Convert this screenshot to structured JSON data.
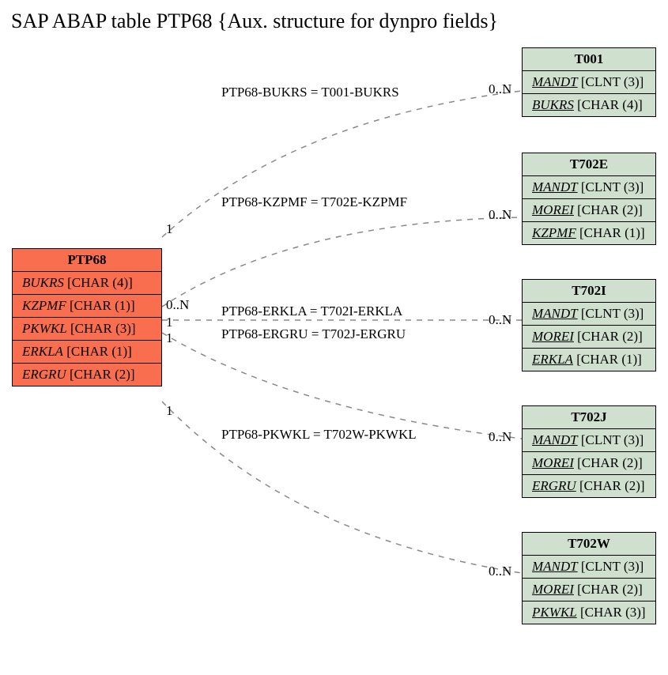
{
  "title": "SAP ABAP table PTP68 {Aux. structure for dynpro fields}",
  "left": {
    "name": "PTP68",
    "fields": [
      {
        "name": "BUKRS",
        "type": "[CHAR (4)]",
        "key": false
      },
      {
        "name": "KZPMF",
        "type": "[CHAR (1)]",
        "key": false
      },
      {
        "name": "PKWKL",
        "type": "[CHAR (3)]",
        "key": false
      },
      {
        "name": "ERKLA",
        "type": "[CHAR (1)]",
        "key": false
      },
      {
        "name": "ERGRU",
        "type": "[CHAR (2)]",
        "key": false
      }
    ]
  },
  "right": [
    {
      "name": "T001",
      "fields": [
        {
          "name": "MANDT",
          "type": "[CLNT (3)]",
          "key": true
        },
        {
          "name": "BUKRS",
          "type": "[CHAR (4)]",
          "key": true
        }
      ]
    },
    {
      "name": "T702E",
      "fields": [
        {
          "name": "MANDT",
          "type": "[CLNT (3)]",
          "key": true
        },
        {
          "name": "MOREI",
          "type": "[CHAR (2)]",
          "key": true
        },
        {
          "name": "KZPMF",
          "type": "[CHAR (1)]",
          "key": true
        }
      ]
    },
    {
      "name": "T702I",
      "fields": [
        {
          "name": "MANDT",
          "type": "[CLNT (3)]",
          "key": true
        },
        {
          "name": "MOREI",
          "type": "[CHAR (2)]",
          "key": true
        },
        {
          "name": "ERKLA",
          "type": "[CHAR (1)]",
          "key": true
        }
      ]
    },
    {
      "name": "T702J",
      "fields": [
        {
          "name": "MANDT",
          "type": "[CLNT (3)]",
          "key": true
        },
        {
          "name": "MOREI",
          "type": "[CHAR (2)]",
          "key": true
        },
        {
          "name": "ERGRU",
          "type": "[CHAR (2)]",
          "key": true
        }
      ]
    },
    {
      "name": "T702W",
      "fields": [
        {
          "name": "MANDT",
          "type": "[CLNT (3)]",
          "key": true
        },
        {
          "name": "MOREI",
          "type": "[CHAR (2)]",
          "key": true
        },
        {
          "name": "PKWKL",
          "type": "[CHAR (3)]",
          "key": true
        }
      ]
    }
  ],
  "edges": [
    {
      "label": "PTP68-BUKRS = T001-BUKRS",
      "left_card": "1",
      "right_card": "0..N"
    },
    {
      "label": "PTP68-KZPMF = T702E-KZPMF",
      "left_card": "0..N",
      "right_card": "0..N"
    },
    {
      "label": "PTP68-ERKLA = T702I-ERKLA",
      "left_card": "1",
      "right_card": "0..N"
    },
    {
      "label": "PTP68-ERGRU = T702J-ERGRU",
      "left_card": "1",
      "right_card": "0..N"
    },
    {
      "label": "PTP68-PKWKL = T702W-PKWKL",
      "left_card": "1",
      "right_card": "0..N"
    }
  ]
}
